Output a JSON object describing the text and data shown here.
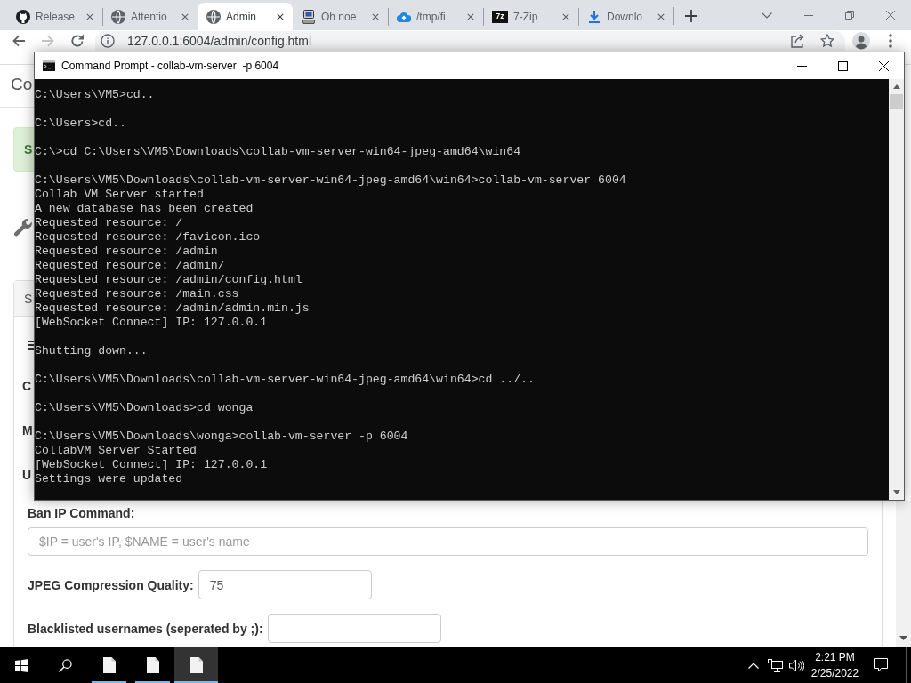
{
  "browser": {
    "tabs": [
      {
        "title": "Release",
        "kind": "cat",
        "selected": false
      },
      {
        "title": "Attentio",
        "kind": "globe",
        "selected": false
      },
      {
        "title": "Admin",
        "kind": "globe",
        "selected": true
      },
      {
        "title": "Oh noe",
        "kind": "computer",
        "selected": false
      },
      {
        "title": "/tmp/fi",
        "kind": "cloud",
        "selected": false
      },
      {
        "title": "7-Zip",
        "kind": "letters",
        "icon_text": "7z",
        "selected": false
      },
      {
        "title": "Downlo",
        "kind": "download",
        "selected": false
      }
    ],
    "nav_buttons": [
      {
        "kind": "back",
        "disabled": false
      },
      {
        "kind": "forward",
        "disabled": true
      },
      {
        "kind": "reload",
        "disabled": false
      }
    ],
    "address": {
      "url": "127.0.0.1:6004/admin/config.html"
    },
    "page": {
      "heading": "Co",
      "alert": "S",
      "panel_title": "S",
      "labels": [
        "C",
        "M",
        "U"
      ],
      "fields": [
        {
          "kind": "stacked",
          "label": "Ban IP Command:",
          "placeholder": "$IP = user's IP, $NAME = user's name"
        },
        {
          "kind": "inline",
          "label": "JPEG Compression Quality:",
          "value": "75"
        },
        {
          "kind": "inline",
          "label": "Blacklisted usernames (seperated by ;):"
        }
      ]
    }
  },
  "console": {
    "title": "Command Prompt - collab-vm-server  -p 6004",
    "blocks": [
      [
        "C:\\Users\\VM5>cd.."
      ],
      [
        "C:\\Users>cd.."
      ],
      [
        "C:\\>cd C:\\Users\\VM5\\Downloads\\collab-vm-server-win64-jpeg-amd64\\win64"
      ],
      [
        "C:\\Users\\VM5\\Downloads\\collab-vm-server-win64-jpeg-amd64\\win64>collab-vm-server 6004",
        "Collab VM Server started",
        "A new database has been created",
        "Requested resource: /",
        "Requested resource: /favicon.ico",
        "Requested resource: /admin",
        "Requested resource: /admin/",
        "Requested resource: /admin/config.html",
        "Requested resource: /main.css",
        "Requested resource: /admin/admin.min.js",
        "[WebSocket Connect] IP: 127.0.0.1"
      ],
      [
        "Shutting down..."
      ],
      [
        "C:\\Users\\VM5\\Downloads\\collab-vm-server-win64-jpeg-amd64\\win64>cd ../.."
      ],
      [
        "C:\\Users\\VM5\\Downloads>cd wonga"
      ],
      [
        "C:\\Users\\VM5\\Downloads\\wonga>collab-vm-server -p 6004",
        "CollabVM Server Started",
        "[WebSocket Connect] IP: 127.0.0.1",
        "Settings were updated"
      ]
    ]
  },
  "taskbar": {
    "apps": [
      {
        "running": true,
        "selected": false
      },
      {
        "running": true,
        "selected": false
      },
      {
        "running": true,
        "selected": true
      }
    ],
    "time": "2:21 PM",
    "date": "2/25/2022"
  }
}
